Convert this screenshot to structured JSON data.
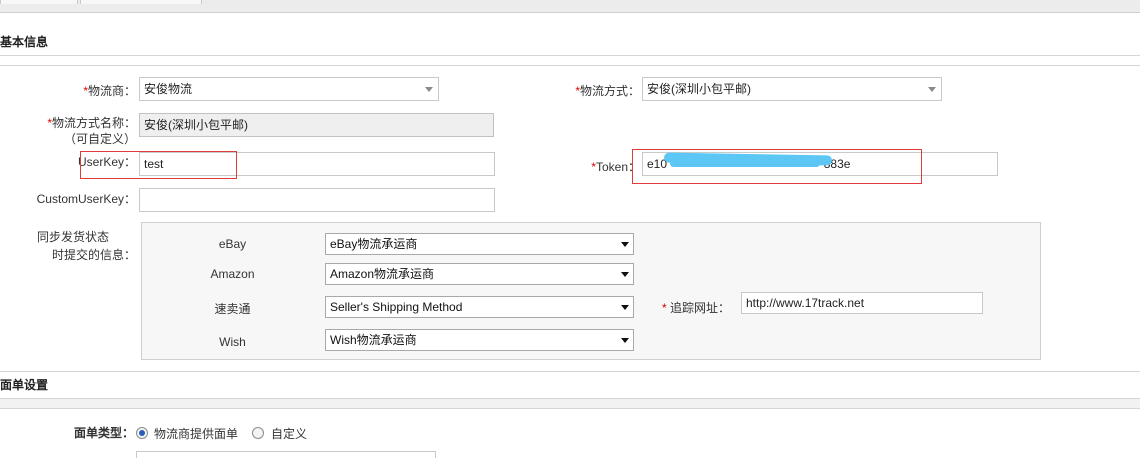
{
  "colors": {
    "required": "#dd0000",
    "highlight": "#e23b3b",
    "redaction": "#5cc7f5"
  },
  "sections": {
    "basic": "基本信息",
    "label": "面单设置"
  },
  "form": {
    "carrier": {
      "label": "物流商：",
      "value": "安俊物流"
    },
    "method": {
      "label": "物流方式：",
      "value": "安俊(深圳小包平邮)"
    },
    "method_name": {
      "label_line1": "物流方式名称：",
      "label_line2": "（可自定义）",
      "value": "安俊(深圳小包平邮)"
    },
    "userkey": {
      "label": "UserKey：",
      "value": "test"
    },
    "token": {
      "label": "Token：",
      "value_prefix": "e10",
      "value_suffix": "883e"
    },
    "customuserkey": {
      "label": "CustomUserKey：",
      "value": ""
    },
    "sync": {
      "label_line1": "同步发货状态",
      "label_line2": "时提交的信息："
    },
    "platforms": [
      {
        "name": "eBay",
        "value": "eBay物流承运商"
      },
      {
        "name": "Amazon",
        "value": "Amazon物流承运商"
      },
      {
        "name": "速卖通",
        "value": "Seller's Shipping Method"
      },
      {
        "name": "Wish",
        "value": "Wish物流承运商"
      }
    ],
    "tracking": {
      "label": "追踪网址：",
      "value": "http://www.17track.net"
    },
    "label_type": {
      "label": "面单类型：",
      "option1": "物流商提供面单",
      "option2": "自定义",
      "selected": "option1"
    },
    "asterisk": "*"
  }
}
